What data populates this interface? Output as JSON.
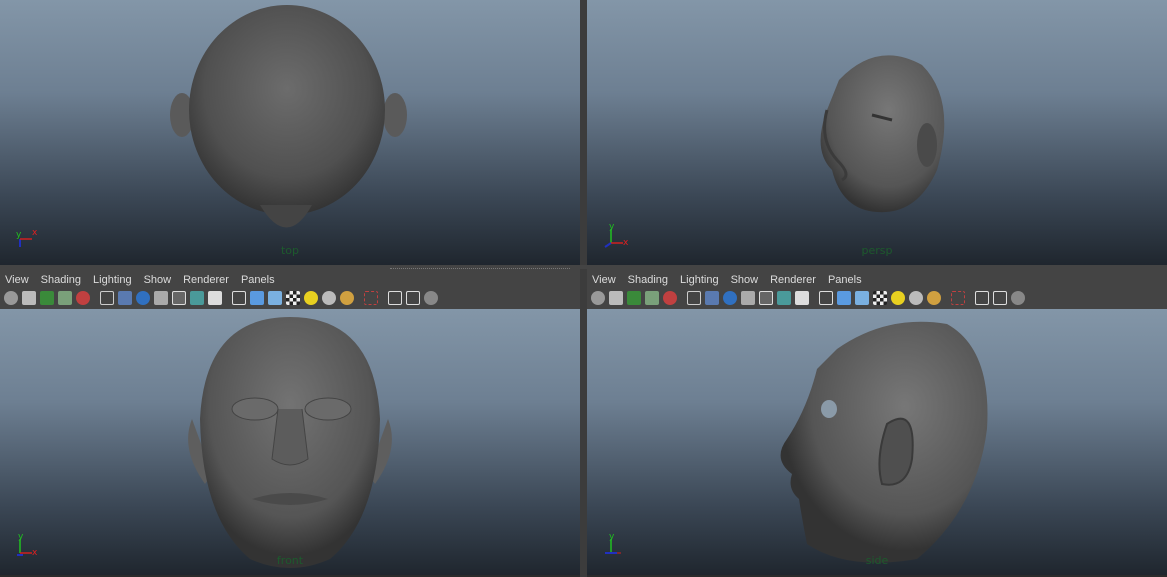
{
  "viewports": {
    "top": {
      "label": "top"
    },
    "persp": {
      "label": "persp"
    },
    "front": {
      "label": "front"
    },
    "side": {
      "label": "side"
    }
  },
  "menus": {
    "left": [
      "View",
      "Shading",
      "Lighting",
      "Show",
      "Renderer",
      "Panels"
    ],
    "right": [
      "View",
      "Shading",
      "Lighting",
      "Show",
      "Renderer",
      "Panels"
    ]
  },
  "axis": {
    "x": "x",
    "y": "y",
    "z": "z"
  },
  "toolbar_icons": [
    "camera-attributes-icon",
    "bookmark-icon",
    "image-plane-icon",
    "grid-icon",
    "film-gate-icon",
    "wireframe-icon",
    "smooth-shade-icon",
    "default-material-icon",
    "isolate-icon",
    "xray-icon",
    "xray-joints-icon",
    "texture-icon",
    "cube-wireframe-icon",
    "cube-shaded-icon",
    "cube-textured-icon",
    "checker-icon",
    "light-icon",
    "shadow-icon",
    "sphere-icon",
    "select-camera-icon",
    "component-icon",
    "instance-icon",
    "nodes-icon"
  ],
  "colors": {
    "viewport_top": "#8396a8",
    "viewport_bottom": "#1f262e",
    "camera_label": "#1d5a2d",
    "axis_x": "#d02020",
    "axis_y": "#20a020",
    "axis_z": "#2030c0"
  }
}
